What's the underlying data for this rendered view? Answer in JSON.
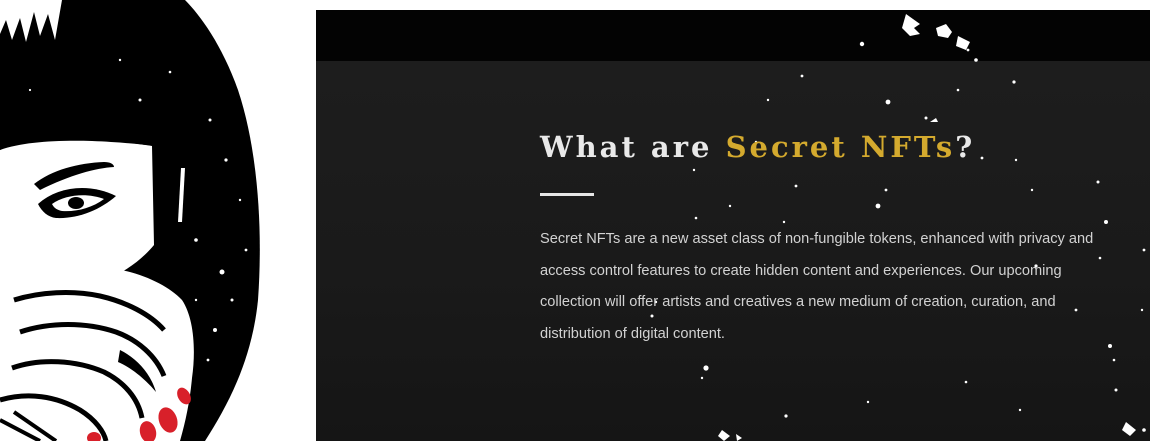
{
  "section": {
    "heading_lead": "What are ",
    "heading_accent": "Secret NFTs",
    "heading_tail": "?",
    "body": "Secret NFTs are a new asset class of non-fungible tokens, enhanced with privacy and access control features to create hidden content and experiences. Our upcoming collection will offer artists and creatives a new medium of creation, curation, and distribution of digital content."
  },
  "illustration": {
    "subject": "woman-with-bangs-covering-face-with-hand",
    "colors": {
      "ink": "#000000",
      "paper": "#ffffff",
      "nails": "#d8202a"
    }
  },
  "colors": {
    "panel": "#1b1b1b",
    "band": "#030303",
    "heading": "#e9e9e9",
    "accent": "#d4aa2e",
    "body_text": "#d2d2d2"
  }
}
